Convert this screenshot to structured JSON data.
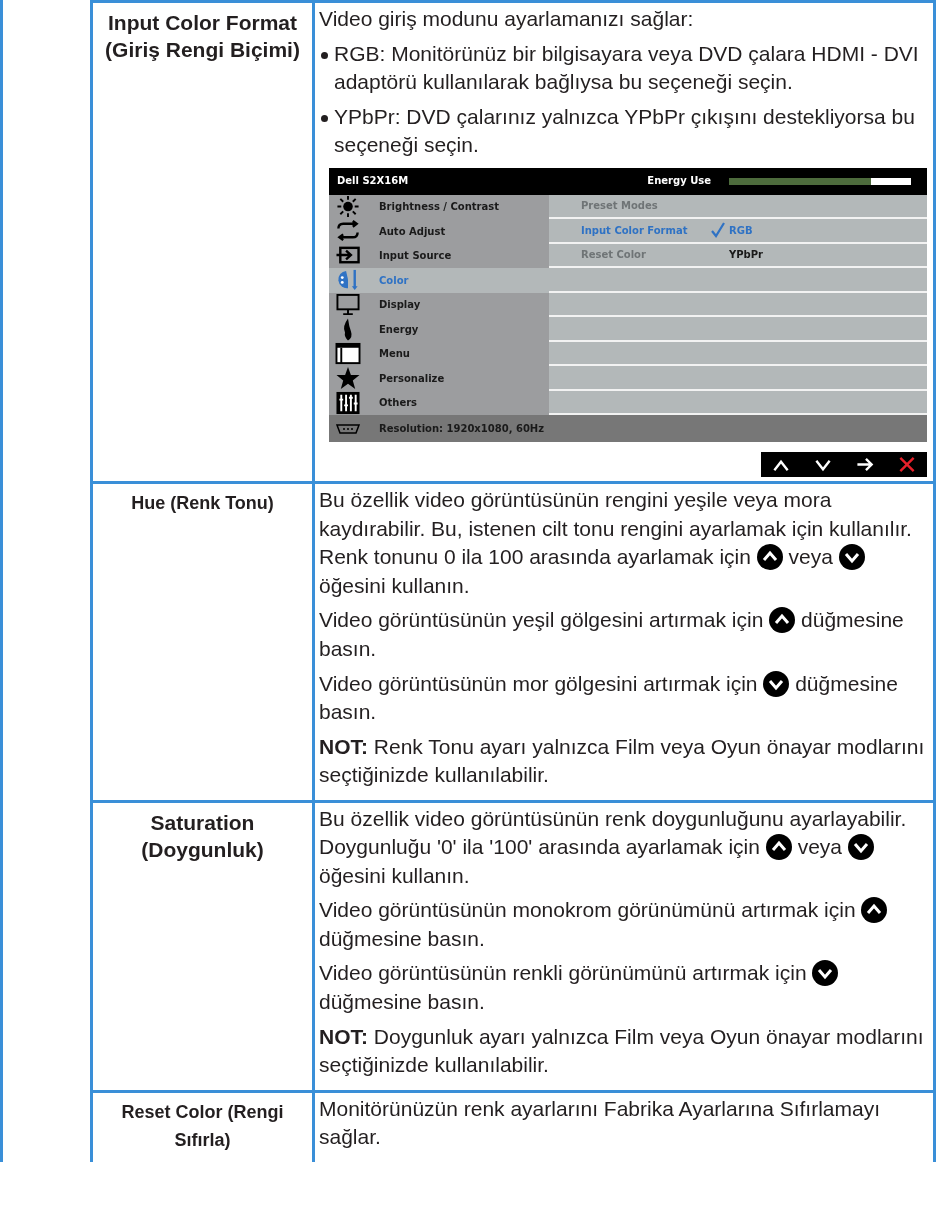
{
  "rows": [
    {
      "label": "Input Color Format (Giriş Rengi Biçimi)",
      "kind": "major",
      "paragraphs": [
        {
          "kind": "text",
          "segments": [
            "Video giriş modunu ayarlamanızı sağlar:"
          ]
        },
        {
          "kind": "bullet",
          "segments": [
            " RGB: Monitörünüz bir bilgisayara veya DVD çalara HDMI - DVI adaptörü kullanılarak bağlıysa bu seçeneği seçin."
          ]
        },
        {
          "kind": "bullet",
          "segments": [
            "YPbPr: DVD çalarınız yalnızca YPbPr çıkışını destekliyorsa bu seçeneği seçin."
          ]
        }
      ],
      "osd": {
        "title": "Dell S2X16M",
        "energy_label": "Energy Use",
        "level": 0.78,
        "menu": [
          {
            "label": "Brightness / Contrast",
            "selected": false
          },
          {
            "label": "Auto Adjust",
            "selected": false
          },
          {
            "label": "Input Source",
            "selected": false
          },
          {
            "label": "Color",
            "selected": true
          },
          {
            "label": "Display",
            "selected": false
          },
          {
            "label": "Energy",
            "selected": false
          },
          {
            "label": "Menu",
            "selected": false
          },
          {
            "label": "Personalize",
            "selected": false
          },
          {
            "label": "Others",
            "selected": false
          }
        ],
        "options": [
          {
            "label": "Preset Modes",
            "disabled": true,
            "selected": false
          },
          {
            "label": "Input Color Format",
            "disabled": false,
            "selected": true,
            "value": "RGB",
            "checked": true
          },
          {
            "label": "Reset Color",
            "disabled": true,
            "selected": false,
            "value": "YPbPr",
            "checked": false
          }
        ],
        "status": "Resolution: 1920x1080, 60Hz",
        "nav_buttons": [
          {
            "kind": "up"
          },
          {
            "kind": "down"
          },
          {
            "kind": "right"
          },
          {
            "kind": "close"
          }
        ]
      }
    },
    {
      "label": "Hue (Renk Tonu)",
      "kind": "minor",
      "paragraphs": [
        {
          "kind": "text",
          "segments": [
            "Bu özellik video görüntüsünün rengini yeşile veya mora kaydırabilir. Bu, istenen cilt tonu rengini ayarlamak için kullanılır. Renk tonunu 0 ila 100 arasında ayarlamak için ",
            {
              "kind": "up"
            },
            " veya ",
            {
              "kind": "down"
            },
            " öğesini kullanın."
          ]
        },
        {
          "kind": "text",
          "segments": [
            "Video görüntüsünün yeşil gölgesini artırmak için ",
            {
              "kind": "up"
            },
            " düğmesine basın."
          ]
        },
        {
          "kind": "text",
          "segments": [
            "Video görüntüsünün mor gölgesini artırmak için ",
            {
              "kind": "down"
            },
            " düğmesine basın."
          ]
        },
        {
          "kind": "text",
          "segments": [
            "**NOT:** Renk Tonu ayarı yalnızca Film veya Oyun önayar modlarını seçtiğinizde kullanılabilir."
          ]
        }
      ]
    },
    {
      "label": "Saturation (Doygunluk)",
      "kind": "major",
      "paragraphs": [
        {
          "kind": "text",
          "segments": [
            "Bu özellik video görüntüsünün renk doygunluğunu ayarlayabilir. Doygunluğu '0' ila '100' arasında ayarlamak için ",
            {
              "kind": "up"
            },
            " veya ",
            {
              "kind": "down"
            },
            " öğesini kullanın."
          ]
        },
        {
          "kind": "text",
          "segments": [
            "Video görüntüsünün monokrom görünümünü artırmak için ",
            {
              "kind": "up"
            },
            " düğmesine basın."
          ]
        },
        {
          "kind": "text",
          "segments": [
            "Video görüntüsünün renkli görünümünü artırmak için ",
            {
              "kind": "down"
            },
            " düğmesine basın."
          ]
        },
        {
          "kind": "text",
          "segments": [
            "**NOT:** Doygunluk ayarı yalnızca Film veya Oyun önayar modlarını seçtiğinizde kullanılabilir."
          ]
        }
      ]
    },
    {
      "label": "Reset Color (Rengi Sıfırla)",
      "kind": "minor",
      "paragraphs": [
        {
          "kind": "text",
          "segments": [
            "Monitörünüzün renk ayarlarını Fabrika Ayarlarına Sıfırlamayı sağlar."
          ]
        }
      ]
    }
  ]
}
